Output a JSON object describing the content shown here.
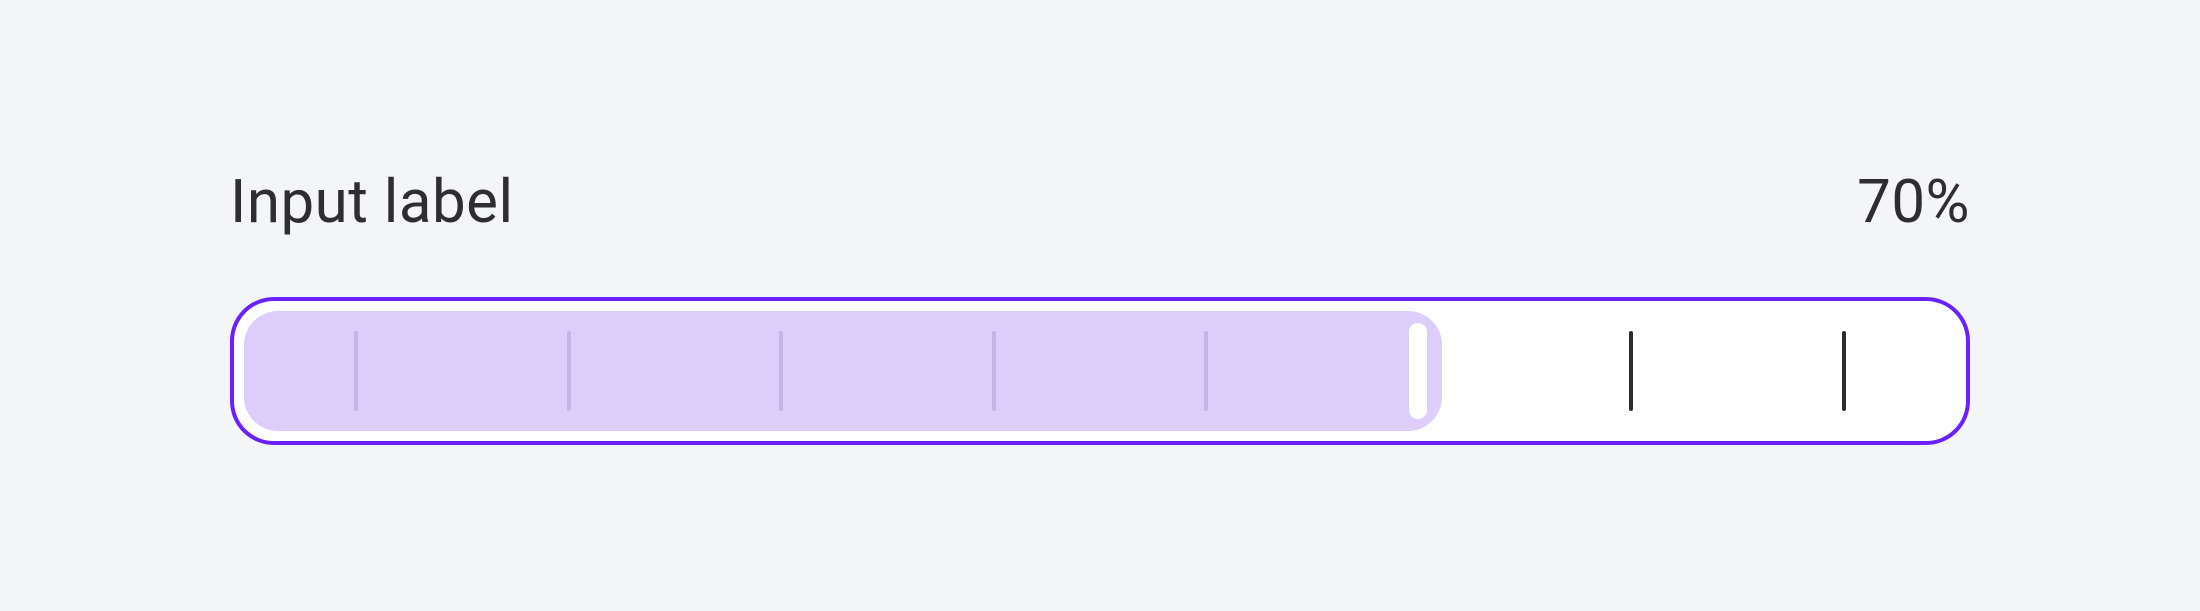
{
  "slider": {
    "label": "Input label",
    "valueText": "70%",
    "percent": 70,
    "totalTicks": 8,
    "ticksBeforeHandle": 6,
    "colors": {
      "border": "#6b21ff",
      "fill": "#dccdfb",
      "handle": "#ffffff",
      "tickLight": "#c3b6e4",
      "tickDark": "#2d2d31"
    }
  }
}
